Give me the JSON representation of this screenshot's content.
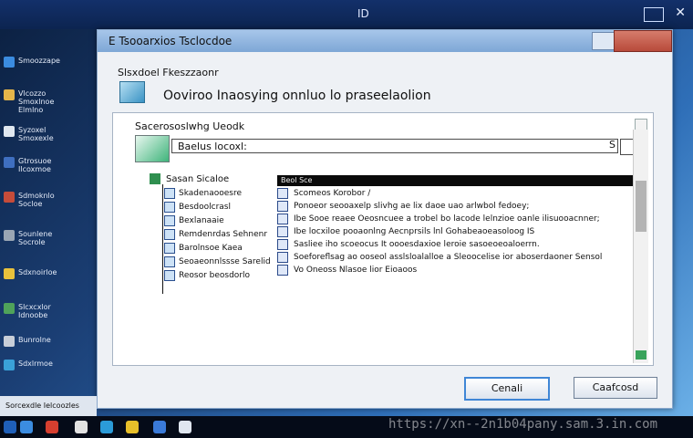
{
  "desktop": {
    "top_title": "ID",
    "close_glyph": "✕",
    "sidebar": [
      {
        "label": "Smoozzape",
        "icon": "app-icon",
        "color": "#3b8ce0"
      },
      {
        "label": "Vlcozzo\nSmoxlnoe\nElmlno",
        "icon": "folder-icon",
        "color": "#e4b54a"
      },
      {
        "label": "Syzoxel\nSmoxexle",
        "icon": "doc-icon",
        "color": "#e0e8f0"
      },
      {
        "label": "Gtrosuoe\nIlcoxmoe",
        "icon": "shield-icon",
        "color": "#3f6fc0"
      },
      {
        "label": "Sdmoknlo\nSocloe",
        "icon": "video-icon",
        "color": "#c64c3a"
      },
      {
        "label": "Sounlene\nSocrole",
        "icon": "drive-icon",
        "color": "#9aa6b4"
      },
      {
        "label": "Sdxnoirloe",
        "icon": "star-icon",
        "color": "#e9c23c"
      },
      {
        "label": "Slcxcxlor\nIdnoobe",
        "icon": "settings-icon",
        "color": "#4fa35a"
      },
      {
        "label": "Bunrolne",
        "icon": "pc-icon",
        "color": "#c8ced8"
      },
      {
        "label": "Sdxlrmoe",
        "icon": "network-icon",
        "color": "#3aa1d8"
      }
    ],
    "notification": "Sorcexdle Ielcoozles"
  },
  "dialog": {
    "title": "E Tsooarxios Tsclocdoe",
    "header_label": "Slsxdoel Fkeszzaonr",
    "header_text": "Ooviroo Inaosying onnluo lo praseelaolion",
    "panel": {
      "label": "Sacerososlwhg Ueodk",
      "search_placeholder": "Baelus locoxl:",
      "search_glyph": "S",
      "tree": {
        "head": "Sasan Sicaloe",
        "items": [
          "Skadenaooesre",
          "Besdoolcrasl",
          "Bexlanaaie",
          "Remdenrdas Sehnenr",
          "Barolnsoe Kaea",
          "Seoaeonnlssse Sarelid",
          "Reosor beosdorlo"
        ]
      },
      "list": {
        "header": "Beol Sce",
        "rows": [
          "Scomeos Korobor /",
          "Ponoeor seooaxelp slivhg ae lix daoe uao arlwbol fedoey;",
          "Ibe Sooe reaee Oeosncuee a trobel bo lacode lelnzioe oanle ilisuooacnner;",
          "Ibe locxiloe pooaonlng Aecnprsils lnl Gohabeaoeasoloog IS",
          "Sasliee iho scoeocus It oooesdaxioe leroie sasoeoeoaloerrn.",
          "Soeforeflsag ao ooseol asslsloalalloe a Sleoocelise ior aboserdaoner Sensol",
          "Vo Oneoss Nlasoe lior Eioaoos"
        ]
      }
    },
    "buttons": {
      "ok": "Cenali",
      "cancel": "Caafcosd"
    }
  },
  "taskbar": {
    "icons": [
      {
        "name": "start-icon",
        "color": "#1f5fb8"
      },
      {
        "name": "browser-icon",
        "color": "#3b8ce0"
      },
      {
        "name": "media-icon",
        "color": "#d63f2f"
      },
      {
        "name": "music-icon",
        "color": "#e2e2e2"
      },
      {
        "name": "explorer-icon",
        "color": "#2b9bd8"
      },
      {
        "name": "chrome-icon",
        "color": "#e7bf2a"
      },
      {
        "name": "store-icon",
        "color": "#3a7ad8"
      },
      {
        "name": "mail-icon",
        "color": "#dfe6ef"
      }
    ]
  },
  "watermark": "https://xn--2n1b04pany.sam.3.in.com"
}
